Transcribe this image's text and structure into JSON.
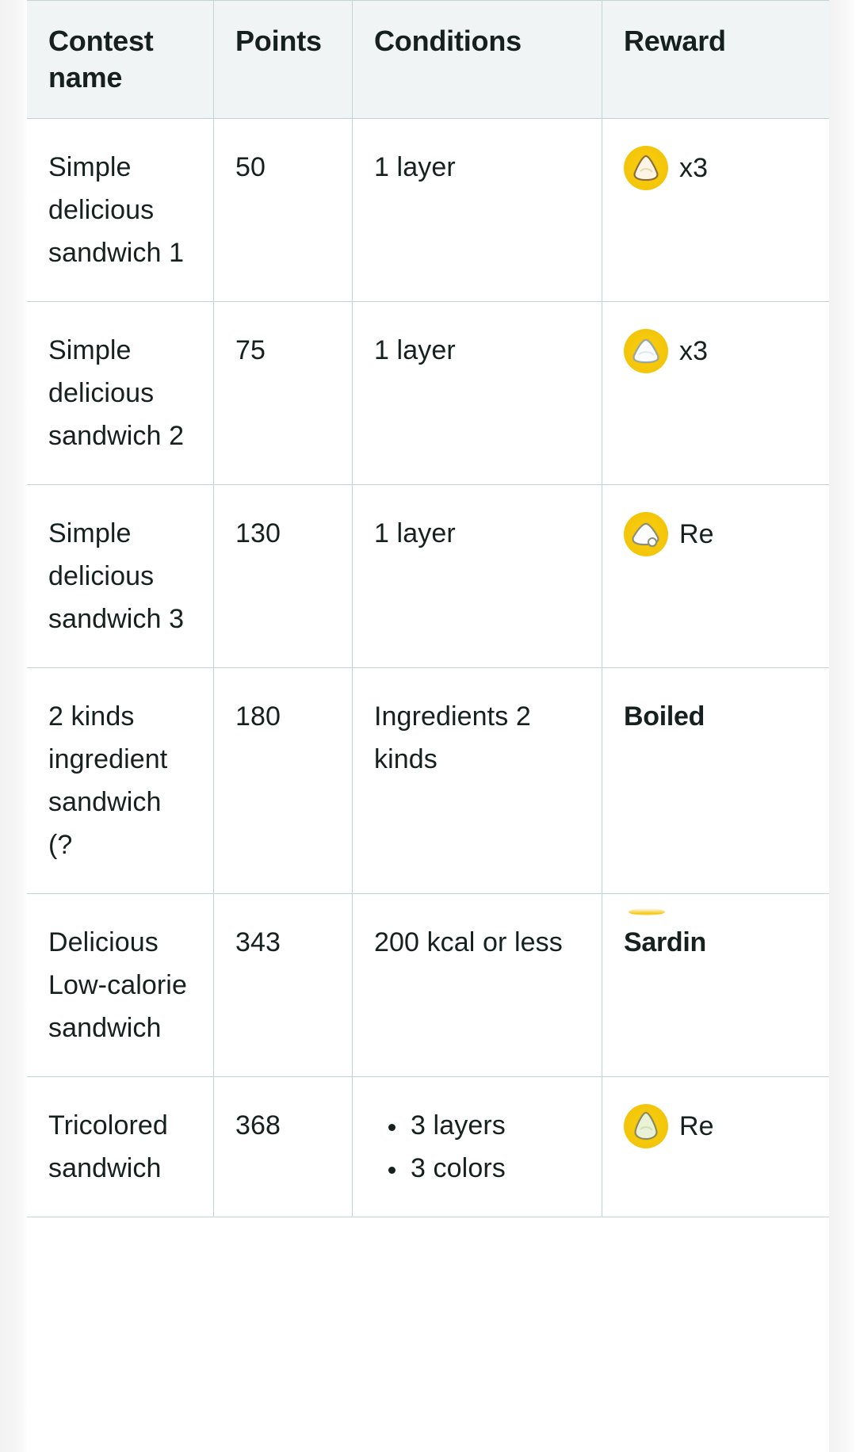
{
  "table": {
    "columns": [
      {
        "key": "contest_name",
        "label": "Contest name"
      },
      {
        "key": "points",
        "label": "Points"
      },
      {
        "key": "conditions",
        "label": "Conditions"
      },
      {
        "key": "reward",
        "label": "Reward"
      }
    ],
    "rows": [
      {
        "contest_name": "Simple delicious sandwich 1",
        "points": "50",
        "conditions": "1 layer",
        "conditions_list": null,
        "reward_icon": "rice-ball-cream-icon",
        "reward_label": "x3",
        "reward_bold": false,
        "reward_has_icon": true,
        "reward_icon_clipped": false
      },
      {
        "contest_name": "Simple delicious sandwich 2",
        "points": "75",
        "conditions": "1 layer",
        "conditions_list": null,
        "reward_icon": "rice-ball-white-icon",
        "reward_label": "x3",
        "reward_bold": false,
        "reward_has_icon": true,
        "reward_icon_clipped": false
      },
      {
        "contest_name": "Simple delicious sandwich 3",
        "points": "130",
        "conditions": "1 layer",
        "conditions_list": null,
        "reward_icon": "rice-ball-pale-icon",
        "reward_label": "Re",
        "reward_bold": false,
        "reward_has_icon": true,
        "reward_icon_clipped": false
      },
      {
        "contest_name": "2 kinds ingredient sandwich (?",
        "points": "180",
        "conditions": "Ingredients 2 kinds",
        "conditions_list": null,
        "reward_icon": null,
        "reward_label": "Boiled",
        "reward_bold": true,
        "reward_has_icon": false,
        "reward_icon_clipped": false
      },
      {
        "contest_name": "Delicious Low-calorie sandwich",
        "points": "343",
        "conditions": "200 kcal or less",
        "conditions_list": null,
        "reward_icon": null,
        "reward_label": "Sardin",
        "reward_bold": true,
        "reward_has_icon": false,
        "reward_icon_clipped": true
      },
      {
        "contest_name": "Tricolored sandwich",
        "points": "368",
        "conditions": null,
        "conditions_list": [
          "3 layers",
          "3 colors"
        ],
        "reward_icon": "rice-ball-green-icon",
        "reward_label": "Re",
        "reward_bold": false,
        "reward_has_icon": true,
        "reward_icon_clipped": false
      }
    ]
  },
  "colors": {
    "header_bg": "#f0f4f4",
    "border": "#c3d3d3",
    "text": "#15201f",
    "row_bg": "#ffffff",
    "icon_gold": "#f5c70b",
    "page_bg": "#ffffff",
    "edge_shadow": "#f3f3f3"
  }
}
